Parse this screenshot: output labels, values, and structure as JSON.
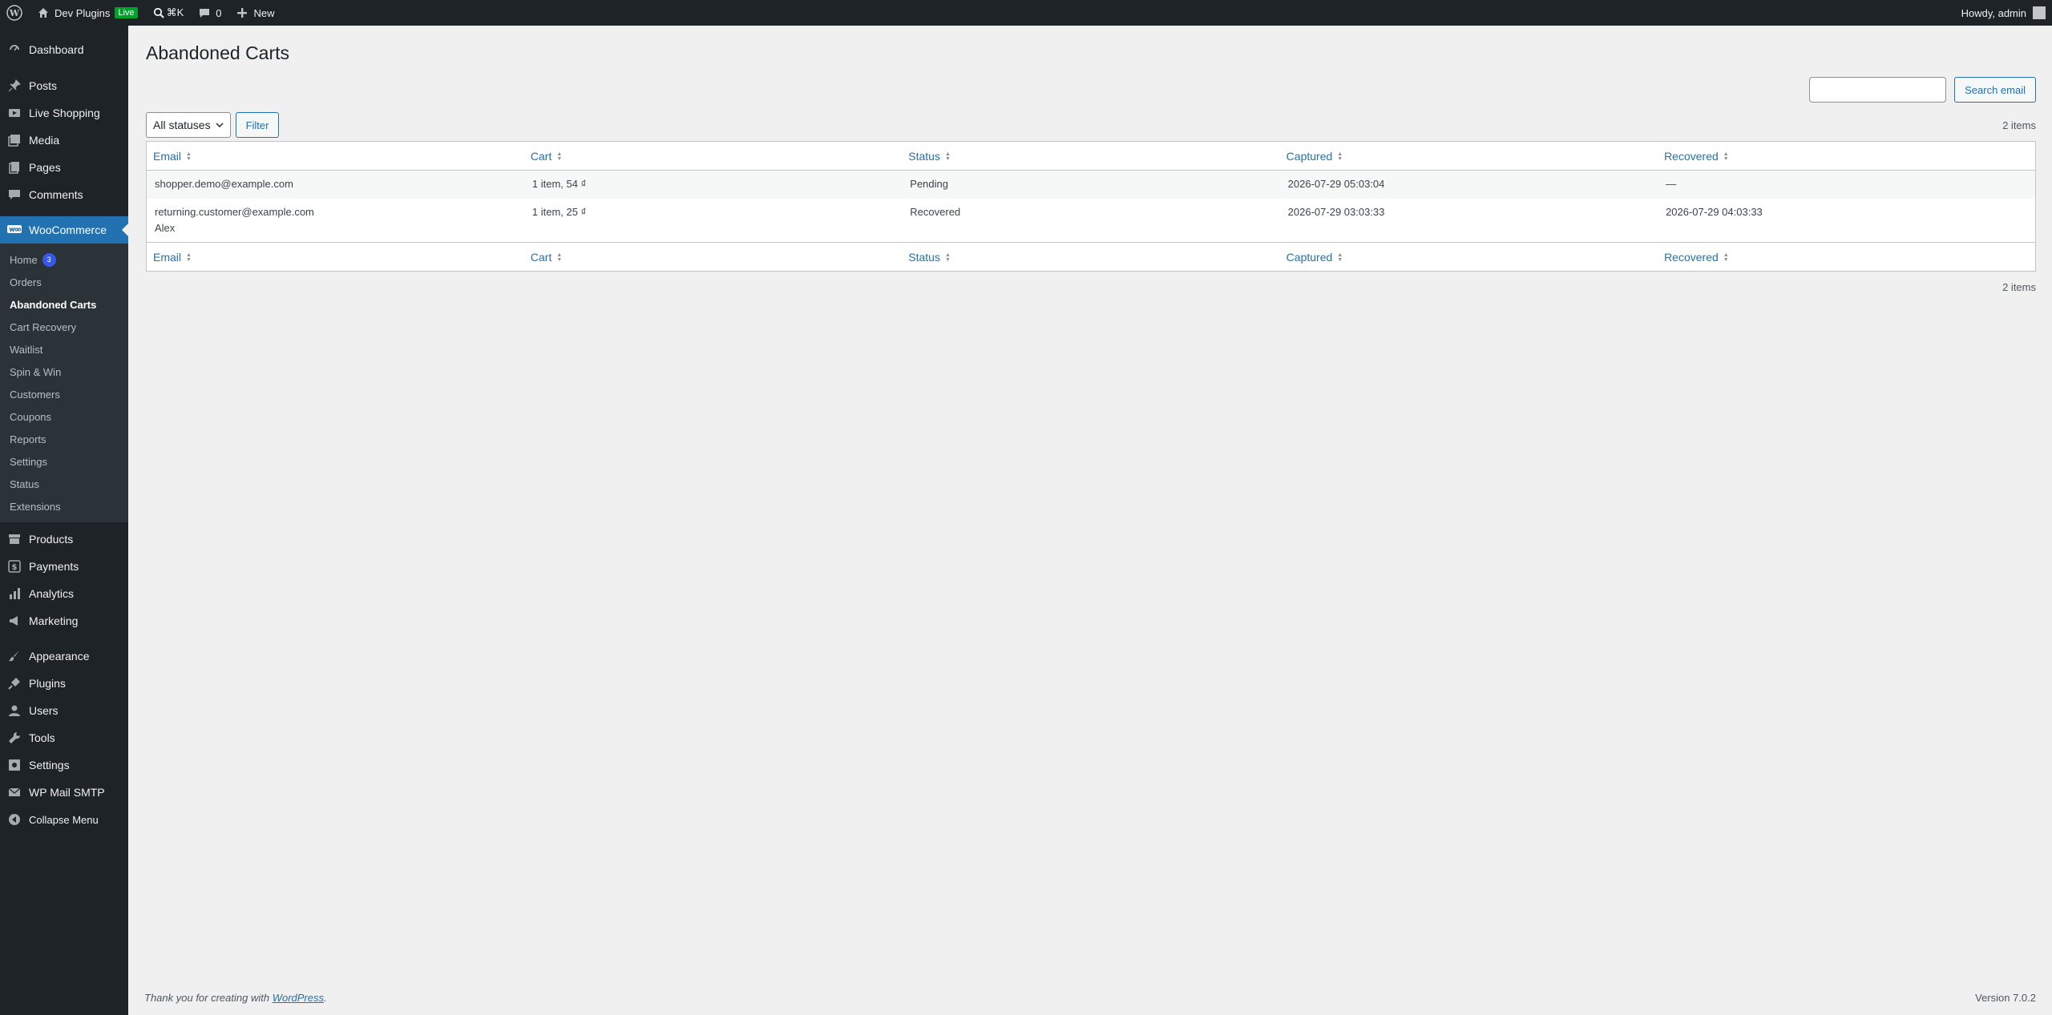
{
  "adminbar": {
    "site_name": "Dev Plugins",
    "live_label": "Live",
    "search_shortcut": "⌘K",
    "comments_count": "0",
    "new_label": "New",
    "greeting": "Howdy, admin"
  },
  "sidebar": {
    "top_items": [
      {
        "label": "Dashboard",
        "icon": "dashboard-icon"
      },
      {
        "label": "Posts",
        "icon": "pin-icon"
      },
      {
        "label": "Live Shopping",
        "icon": "video-icon"
      },
      {
        "label": "Media",
        "icon": "media-icon"
      },
      {
        "label": "Pages",
        "icon": "pages-icon"
      },
      {
        "label": "Comments",
        "icon": "comment-icon"
      },
      {
        "label": "WooCommerce",
        "icon": "woo-icon"
      }
    ],
    "woo_submenu": [
      {
        "label": "Home",
        "badge": "3"
      },
      {
        "label": "Orders"
      },
      {
        "label": "Abandoned Carts",
        "current": true
      },
      {
        "label": "Cart Recovery"
      },
      {
        "label": "Waitlist"
      },
      {
        "label": "Spin & Win"
      },
      {
        "label": "Customers"
      },
      {
        "label": "Coupons"
      },
      {
        "label": "Reports"
      },
      {
        "label": "Settings"
      },
      {
        "label": "Status"
      },
      {
        "label": "Extensions"
      }
    ],
    "bottom_items": [
      {
        "label": "Products",
        "icon": "archive-icon"
      },
      {
        "label": "Payments",
        "icon": "dollar-icon"
      },
      {
        "label": "Analytics",
        "icon": "chart-icon"
      },
      {
        "label": "Marketing",
        "icon": "megaphone-icon"
      },
      {
        "label": "Appearance",
        "icon": "brush-icon"
      },
      {
        "label": "Plugins",
        "icon": "plug-icon"
      },
      {
        "label": "Users",
        "icon": "user-icon"
      },
      {
        "label": "Tools",
        "icon": "wrench-icon"
      },
      {
        "label": "Settings",
        "icon": "settings-icon"
      },
      {
        "label": "WP Mail SMTP",
        "icon": "mail-icon"
      },
      {
        "label": "Collapse Menu",
        "icon": "collapse-icon"
      }
    ]
  },
  "page": {
    "title": "Abandoned Carts",
    "search_button": "Search email",
    "search_value": "",
    "status_select": "All statuses",
    "filter_button": "Filter",
    "items_count": "2 items"
  },
  "table": {
    "columns": [
      "Email",
      "Cart",
      "Status",
      "Captured",
      "Recovered"
    ],
    "rows": [
      {
        "email": "shopper.demo@example.com",
        "name": "",
        "cart": "1 item, 54 ₫",
        "status": "Pending",
        "captured": "2026-07-29 05:03:04",
        "recovered": "—"
      },
      {
        "email": "returning.customer@example.com",
        "name": "Alex",
        "cart": "1 item, 25 ₫",
        "status": "Recovered",
        "captured": "2026-07-29 03:03:33",
        "recovered": "2026-07-29 04:03:33"
      }
    ]
  },
  "footer": {
    "thanks_prefix": "Thank you for creating with ",
    "thanks_link": "WordPress",
    "thanks_suffix": ".",
    "version": "Version 7.0.2"
  },
  "colors": {
    "adminbar_bg": "#1d2327",
    "accent": "#2271b1",
    "pending": "#b35d00",
    "recovered": "#00a32a"
  }
}
